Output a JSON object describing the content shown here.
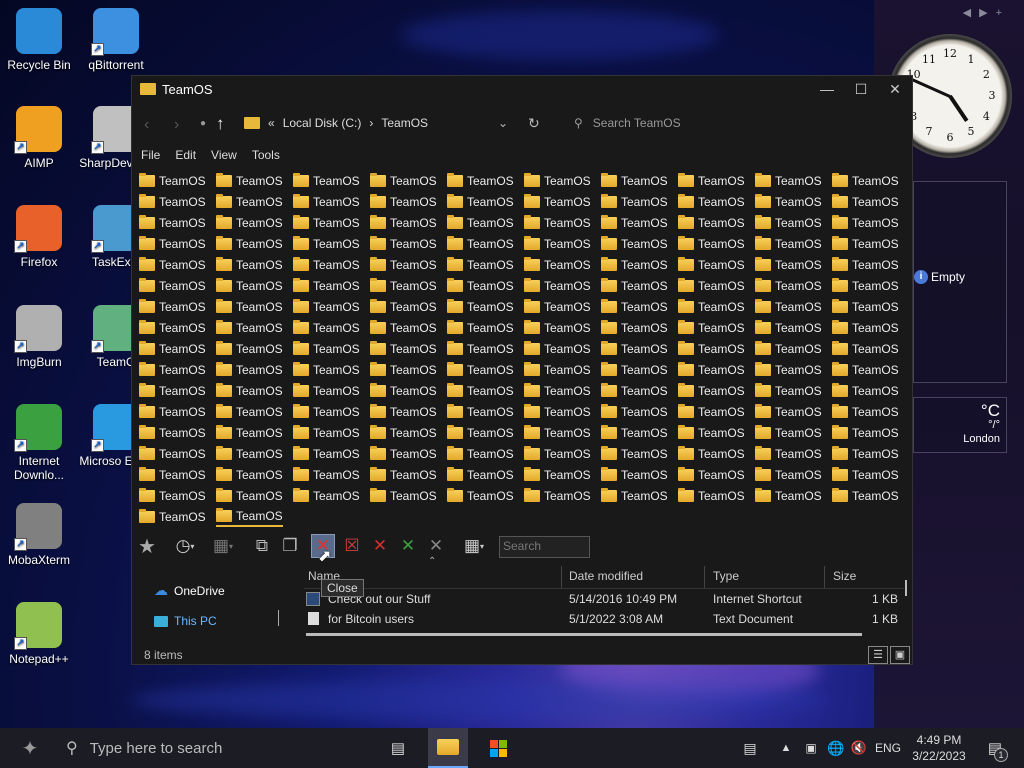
{
  "desktop": {
    "icons": [
      {
        "label": "Recycle Bin",
        "icon": "recycle-bin-icon",
        "color": "#2a8ad8"
      },
      {
        "label": "qBittorrent",
        "icon": "qbittorrent-icon",
        "color": "#3d8fe0"
      },
      {
        "label": "AIMP",
        "icon": "aimp-icon",
        "color": "#f0a020"
      },
      {
        "label": "SharpDev 4.4",
        "icon": "sharpdevelop-icon",
        "color": "#c0c0c0"
      },
      {
        "label": "Firefox",
        "icon": "firefox-icon",
        "color": "#e8602a"
      },
      {
        "label": "TaskExpl",
        "icon": "taskexplorer-icon",
        "color": "#4a9ad0"
      },
      {
        "label": "ImgBurn",
        "icon": "imgburn-icon",
        "color": "#b0b0b0"
      },
      {
        "label": "TeamO",
        "icon": "teamos-icon",
        "color": "#60b080"
      },
      {
        "label": "Internet Downlo...",
        "icon": "idm-icon",
        "color": "#3aa040"
      },
      {
        "label": "Microso Edge",
        "icon": "edge-icon",
        "color": "#2a9ae0"
      },
      {
        "label": "MobaXterm",
        "icon": "mobaxterm-icon",
        "color": "#808080"
      },
      {
        "label": "Notepad++",
        "icon": "notepadpp-icon",
        "color": "#90c050"
      }
    ]
  },
  "gadgets": {
    "clock_numbers": [
      "12",
      "1",
      "2",
      "3",
      "4",
      "5",
      "6",
      "7",
      "8",
      "9",
      "10",
      "11"
    ],
    "info_text": "Empty",
    "weather_unit": "°C",
    "weather_value": "°/°",
    "weather_city": "London"
  },
  "explorer": {
    "title": "TeamOS",
    "window_controls": {
      "minimize": "—",
      "maximize": "☐",
      "close": "✕"
    },
    "breadcrumb": {
      "prefix": "«",
      "drive": "Local Disk (C:)",
      "sep": "›",
      "folder": "TeamOS"
    },
    "search_placeholder": "Search TeamOS",
    "menu": [
      "File",
      "Edit",
      "View",
      "Tools"
    ],
    "folder_label": "TeamOS",
    "grid_columns": 10,
    "grid_rows": 16,
    "last_row": 2,
    "toolbar_search_placeholder": "Search",
    "tooltip": "Close",
    "nav_pane": [
      "OneDrive",
      "This PC"
    ],
    "columns": [
      "Name",
      "Date modified",
      "Type",
      "Size"
    ],
    "files": [
      {
        "name": "Check out our Stuff",
        "date": "5/14/2016 10:49 PM",
        "type": "Internet Shortcut",
        "size": "1 KB"
      },
      {
        "name": "for Bitcoin users",
        "date": "5/1/2022 3:08 AM",
        "type": "Text Document",
        "size": "1 KB"
      }
    ],
    "status": "8 items"
  },
  "taskbar": {
    "search_placeholder": "Type here to search",
    "language": "ENG",
    "time": "4:49 PM",
    "date": "3/22/2023",
    "notification_count": "1"
  }
}
